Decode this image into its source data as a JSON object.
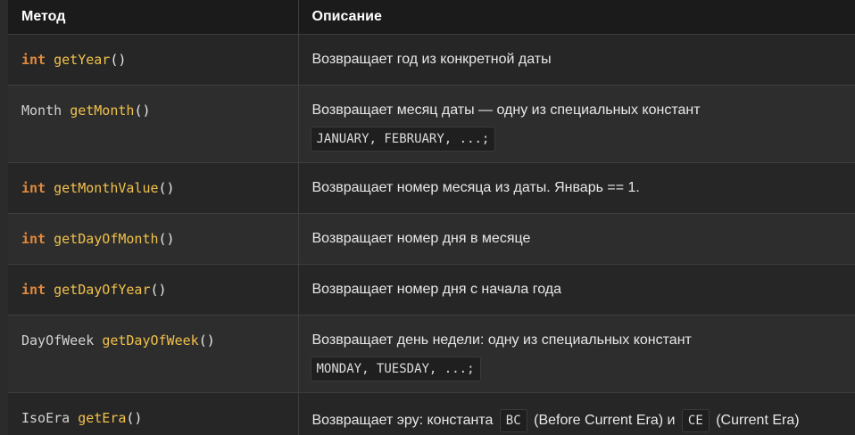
{
  "table": {
    "headers": [
      "Метод",
      "Описание"
    ],
    "rows": [
      {
        "method": {
          "keyword": "int",
          "type": "",
          "name": "getYear",
          "parens": "()"
        },
        "desc": "Возвращает год из конкретной даты",
        "code": ""
      },
      {
        "method": {
          "keyword": "",
          "type": "Month",
          "name": "getMonth",
          "parens": "()"
        },
        "desc": "Возвращает месяц даты — одну из специальных констант",
        "code": "JANUARY, FEBRUARY, ...;"
      },
      {
        "method": {
          "keyword": "int",
          "type": "",
          "name": "getMonthValue",
          "parens": "()"
        },
        "desc": "Возвращает номер месяца из даты. Январь == 1.",
        "code": ""
      },
      {
        "method": {
          "keyword": "int",
          "type": "",
          "name": "getDayOfMonth",
          "parens": "()"
        },
        "desc": "Возвращает номер дня в месяце",
        "code": ""
      },
      {
        "method": {
          "keyword": "int",
          "type": "",
          "name": "getDayOfYear",
          "parens": "()"
        },
        "desc": "Возвращает номер дня с начала года",
        "code": ""
      },
      {
        "method": {
          "keyword": "",
          "type": "DayOfWeek",
          "name": "getDayOfWeek",
          "parens": "()"
        },
        "desc": "Возвращает день недели: одну из специальных констант",
        "code": "MONDAY, TUESDAY, ...;"
      },
      {
        "method": {
          "keyword": "",
          "type": "IsoEra",
          "name": "getEra",
          "parens": "()"
        },
        "desc_parts": [
          "Возвращает эру: константа",
          "BC",
          "(Before Current Era) и",
          "CE",
          "(Current Era)"
        ],
        "code": ""
      }
    ]
  },
  "colors": {
    "background": "#2b2b2b",
    "header_bg": "#1b1b1b",
    "keyword": "#e08a3c",
    "method_name": "#f0c14b",
    "text": "#e8e8e8"
  }
}
